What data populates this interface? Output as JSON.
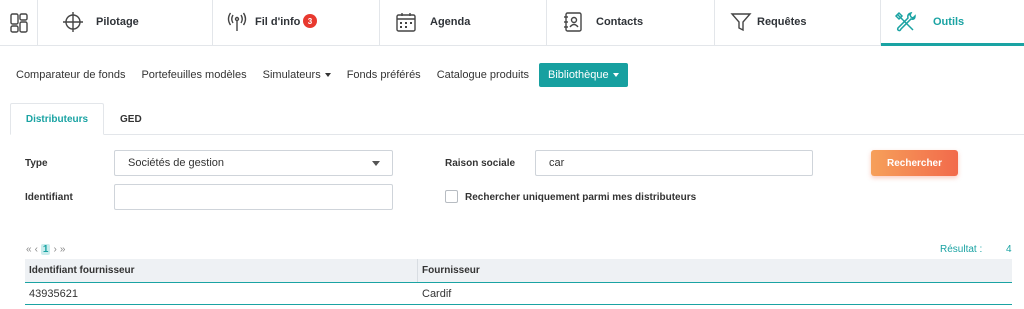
{
  "nav": {
    "tabs": [
      {
        "label": "Pilotage",
        "icon": "crosshair-icon"
      },
      {
        "label": "Fil d'info",
        "icon": "antenna-icon",
        "badge": "3"
      },
      {
        "label": "Agenda",
        "icon": "calendar-icon"
      },
      {
        "label": "Contacts",
        "icon": "contacts-book-icon"
      },
      {
        "label": "Requêtes",
        "icon": "filter-icon"
      },
      {
        "label": "Outils",
        "icon": "tools-icon",
        "active": true
      }
    ]
  },
  "submenu": {
    "items": [
      {
        "label": "Comparateur de fonds"
      },
      {
        "label": "Portefeuilles modèles"
      },
      {
        "label": "Simulateurs",
        "dropdown": true
      },
      {
        "label": "Fonds préférés"
      },
      {
        "label": "Catalogue produits"
      },
      {
        "label": "Bibliothèque",
        "dropdown": true,
        "active": true
      }
    ]
  },
  "tabs": [
    {
      "label": "Distributeurs",
      "active": true
    },
    {
      "label": "GED"
    }
  ],
  "form": {
    "type_label": "Type",
    "type_value": "Sociétés de gestion",
    "identifiant_label": "Identifiant",
    "identifiant_value": "",
    "raison_sociale_label": "Raison sociale",
    "raison_sociale_value": "car",
    "checkbox_label": "Rechercher uniquement parmi mes distributeurs",
    "search_button": "Rechercher"
  },
  "pagination": {
    "first": "«",
    "prev": "‹",
    "current_page": "1",
    "next": "›",
    "last": "»"
  },
  "result": {
    "label": "Résultat :",
    "count": "4"
  },
  "table": {
    "columns": [
      "Identifiant fournisseur",
      "Fournisseur"
    ],
    "rows": [
      [
        "43935621",
        "Cardif"
      ]
    ]
  },
  "colors": {
    "accent": "#1aa3a3",
    "badge": "#e8392f",
    "search_button": "#f26a4b"
  }
}
